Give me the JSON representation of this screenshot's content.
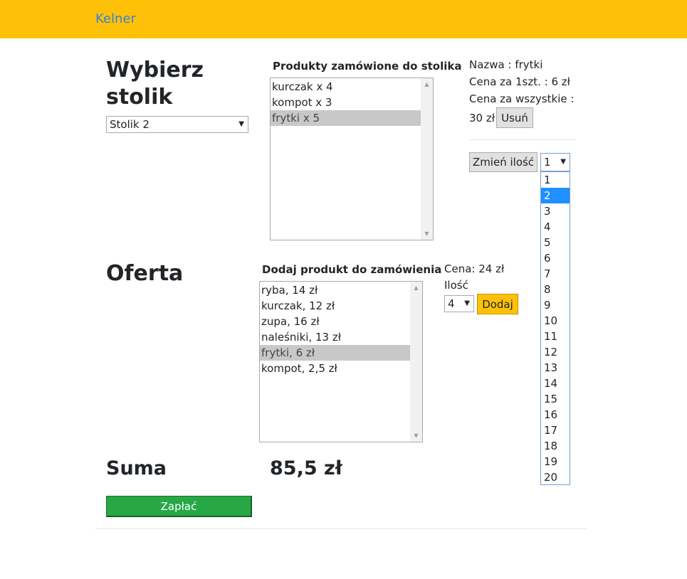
{
  "navbar": {
    "brand": "Kelner"
  },
  "table_section": {
    "heading": "Wybierz stolik",
    "heading_line1": "Wybierz",
    "heading_line2": "stolik",
    "table_select_value": "Stolik 2"
  },
  "ordered": {
    "heading": "Produkty zamówione do stolika",
    "items": [
      {
        "label": "kurczak x 4",
        "selected": false
      },
      {
        "label": "kompot x 3",
        "selected": false
      },
      {
        "label": "frytki x 5",
        "selected": true
      }
    ]
  },
  "details": {
    "name_line": "Nazwa : frytki",
    "unit_price_line": "Cena za 1szt. : 6 zł",
    "total_price_label": "Cena za wszystkie :",
    "total_price_value": "30 zł",
    "remove_button": "Usuń",
    "change_qty_button": "Zmień ilość",
    "qty_select_value": "1",
    "qty_options": [
      "1",
      "2",
      "3",
      "4",
      "5",
      "6",
      "7",
      "8",
      "9",
      "10",
      "11",
      "12",
      "13",
      "14",
      "15",
      "16",
      "17",
      "18",
      "19",
      "20"
    ],
    "qty_highlighted": "2"
  },
  "offer": {
    "heading": "Oferta",
    "list_heading": "Dodaj produkt do zamówienia",
    "items": [
      {
        "label": "ryba, 14 zł",
        "selected": false
      },
      {
        "label": "kurczak, 12 zł",
        "selected": false
      },
      {
        "label": "zupa, 16 zł",
        "selected": false
      },
      {
        "label": "naleśniki, 13 zł",
        "selected": false
      },
      {
        "label": "frytki, 6 zł",
        "selected": true
      },
      {
        "label": "kompot, 2,5 zł",
        "selected": false
      }
    ],
    "price_line": "Cena: 24 zł",
    "qty_label": "Ilość",
    "qty_value": "4",
    "add_button": "Dodaj"
  },
  "summary": {
    "label": "Suma",
    "value": "85,5 zł",
    "pay_button": "Zapłać"
  },
  "colors": {
    "navbar": "#ffc107",
    "brand": "#3b82d6",
    "pay": "#28a745",
    "highlight": "#1e90ff"
  }
}
